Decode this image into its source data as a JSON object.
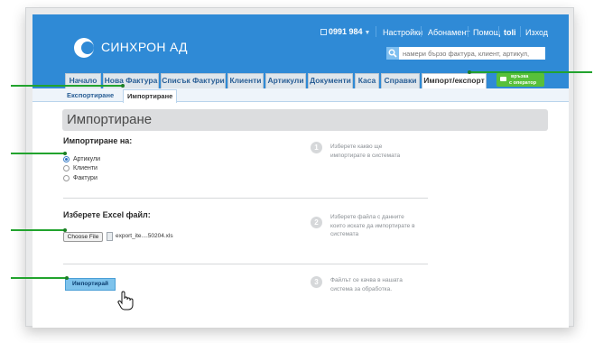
{
  "header": {
    "brand": "СИНХРОН АД",
    "phone": "0991 984",
    "links": {
      "settings": "Настройки",
      "subscription": "Абонамент",
      "help": "Помощ"
    },
    "user": "toli",
    "logout": "Изход"
  },
  "search": {
    "placeholder": "намери бързо фактура, клиент, артикул,"
  },
  "tabs": [
    "Начало",
    "Нова Фактура",
    "Списък Фактури",
    "Клиенти",
    "Артикули",
    "Документи",
    "Каса",
    "Справки",
    "Импорт/експорт"
  ],
  "chat": {
    "line1": "връзка",
    "line2": "с оператор"
  },
  "subtabs": [
    "Експортиране",
    "Импортиране"
  ],
  "page": {
    "title": "Импортиране"
  },
  "import_on": {
    "title": "Импортиране на:",
    "options": [
      "Артикули",
      "Клиенти",
      "Фактури"
    ],
    "selected": "Артикули"
  },
  "file": {
    "title": "Изберете Excel файл:",
    "button": "Choose File",
    "name": "export_ite....50204.xls"
  },
  "import_button": "Импортирай",
  "steps": [
    {
      "num": "1",
      "lines": [
        "Изберете какво ще",
        "импортирате в системата"
      ]
    },
    {
      "num": "2",
      "lines": [
        "Изберете файла с данните",
        "които искате да импортирате в",
        "системата"
      ]
    },
    {
      "num": "3",
      "lines": [
        "Файлът се качва в нашата",
        "система за обработка."
      ]
    }
  ],
  "colors": {
    "header": "#2f8ad6",
    "accent_green": "#58c03a",
    "callout": "#22a32e",
    "import_button": "#7ec3ec"
  }
}
